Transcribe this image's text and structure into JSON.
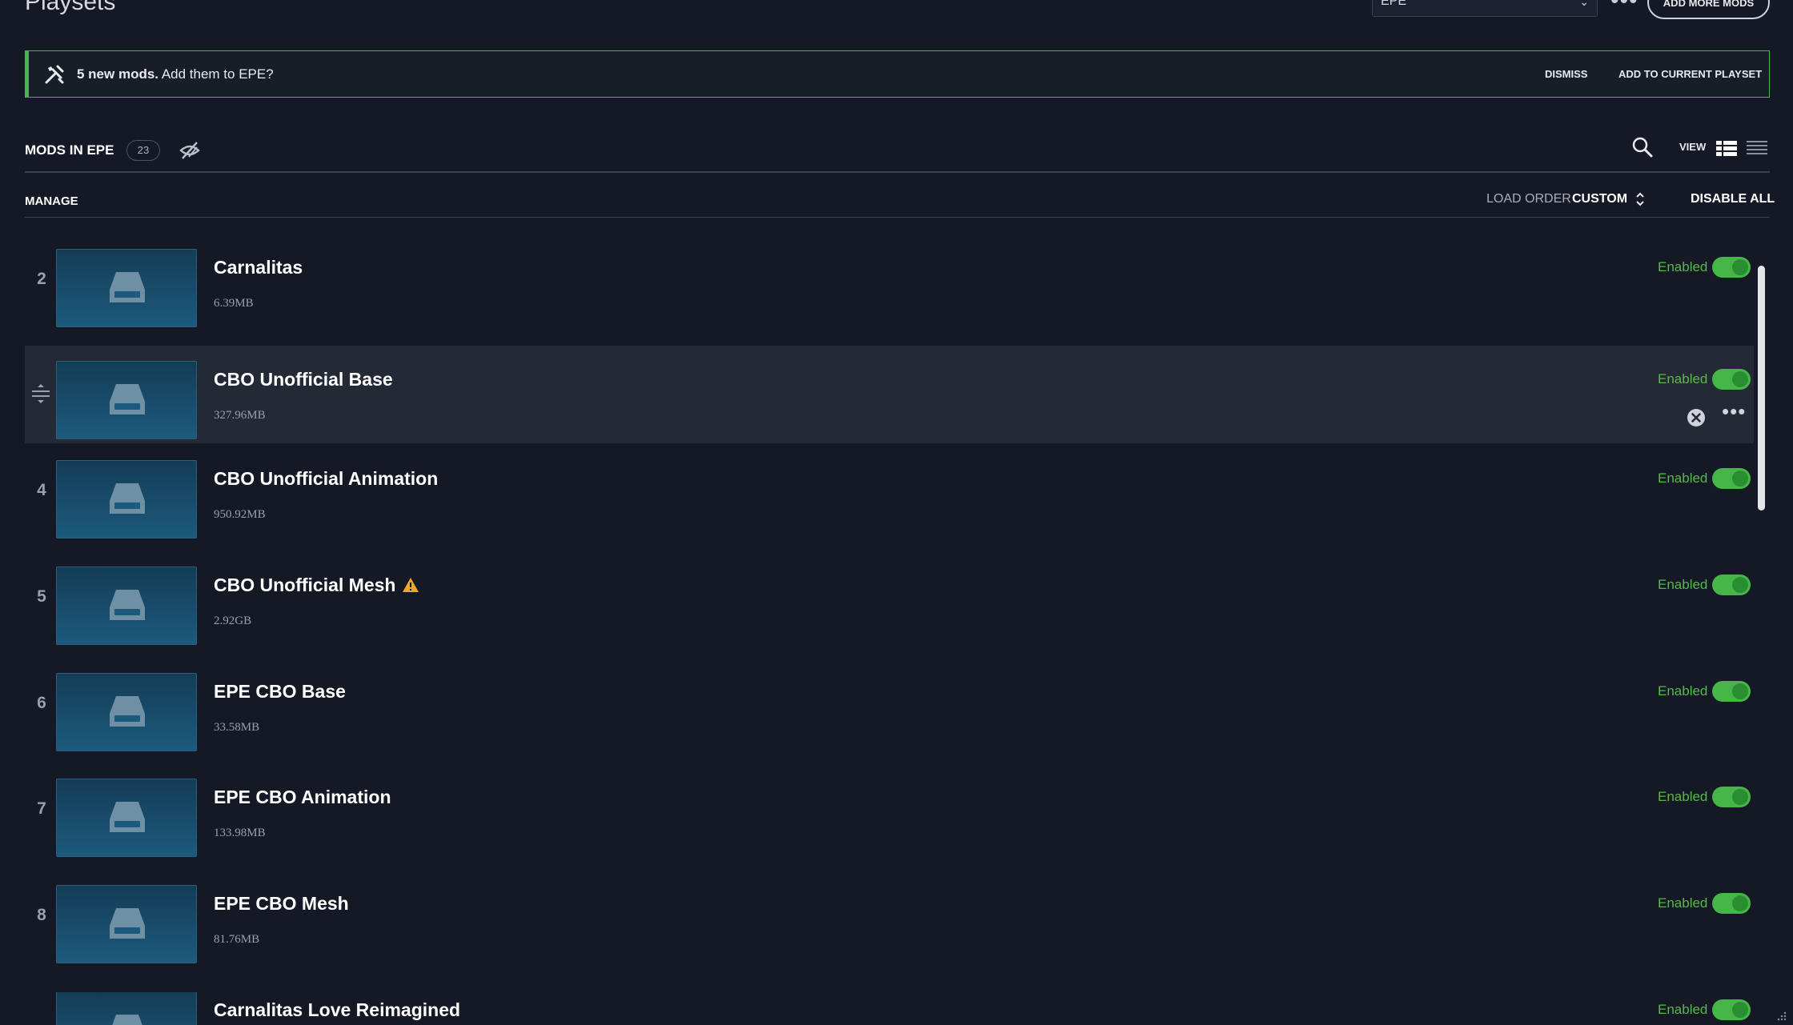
{
  "page": {
    "title": "Playsets"
  },
  "topbar": {
    "playset_value": "EPE",
    "more_glyph": "•••",
    "add_more_label": "ADD MORE MODS"
  },
  "banner": {
    "bold": "5 new mods.",
    "text": " Add them to EPE?",
    "dismiss": "DISMISS",
    "add": "ADD TO CURRENT PLAYSET",
    "accent": "#46b649"
  },
  "section": {
    "title": "MODS IN EPE",
    "count": "23",
    "view_label": "VIEW",
    "manage": "MANAGE",
    "load_order_label": "LOAD ORDER",
    "load_order_value": "CUSTOM",
    "disable_all": "DISABLE ALL"
  },
  "mods": [
    {
      "num": "2",
      "name": "Carnalitas",
      "size": "6.39MB",
      "status": "Enabled",
      "enabled": true,
      "warning": false
    },
    {
      "num": "",
      "name": "CBO Unofficial Base",
      "size": "327.96MB",
      "status": "Enabled",
      "enabled": true,
      "warning": false
    },
    {
      "num": "4",
      "name": "CBO Unofficial Animation",
      "size": "950.92MB",
      "status": "Enabled",
      "enabled": true,
      "warning": false
    },
    {
      "num": "5",
      "name": "CBO Unofficial Mesh",
      "size": "2.92GB",
      "status": "Enabled",
      "enabled": true,
      "warning": true
    },
    {
      "num": "6",
      "name": "EPE CBO Base",
      "size": "33.58MB",
      "status": "Enabled",
      "enabled": true,
      "warning": false
    },
    {
      "num": "7",
      "name": "EPE CBO Animation",
      "size": "133.98MB",
      "status": "Enabled",
      "enabled": true,
      "warning": false
    },
    {
      "num": "8",
      "name": "EPE CBO Mesh",
      "size": "81.76MB",
      "status": "Enabled",
      "enabled": true,
      "warning": false
    },
    {
      "num": "",
      "name": "Carnalitas Love Reimagined",
      "size": "",
      "status": "Enabled",
      "enabled": true,
      "warning": false
    }
  ],
  "colors": {
    "background": "#141925",
    "enabled_green": "#57b94a",
    "toggle_green": "#46b649",
    "warning": "#f0a531"
  }
}
